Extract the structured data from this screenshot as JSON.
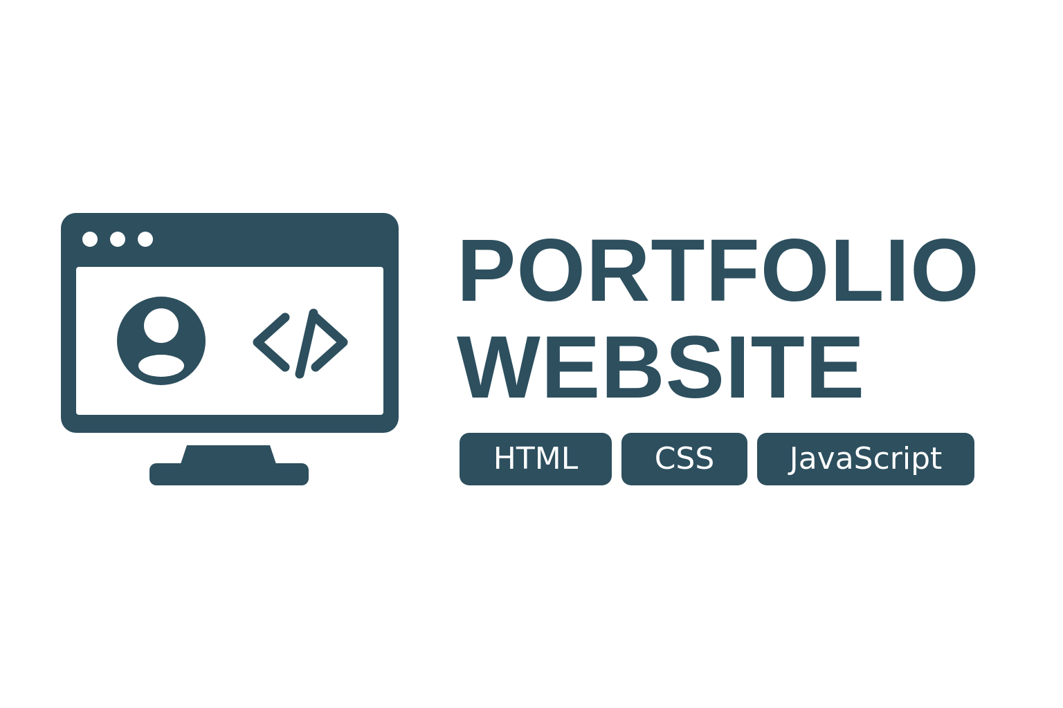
{
  "title": {
    "line1": "PORTFOLIO",
    "line2": "WEBSITE"
  },
  "tags": [
    {
      "label": "HTML"
    },
    {
      "label": "CSS"
    },
    {
      "label": "JavaScript"
    }
  ],
  "icons": {
    "monitor": "monitor-icon",
    "user": "user-avatar-icon",
    "code": "code-brackets-icon"
  },
  "colors": {
    "primary": "#2d4f5e",
    "background": "#ffffff",
    "tag_text": "#ffffff"
  }
}
